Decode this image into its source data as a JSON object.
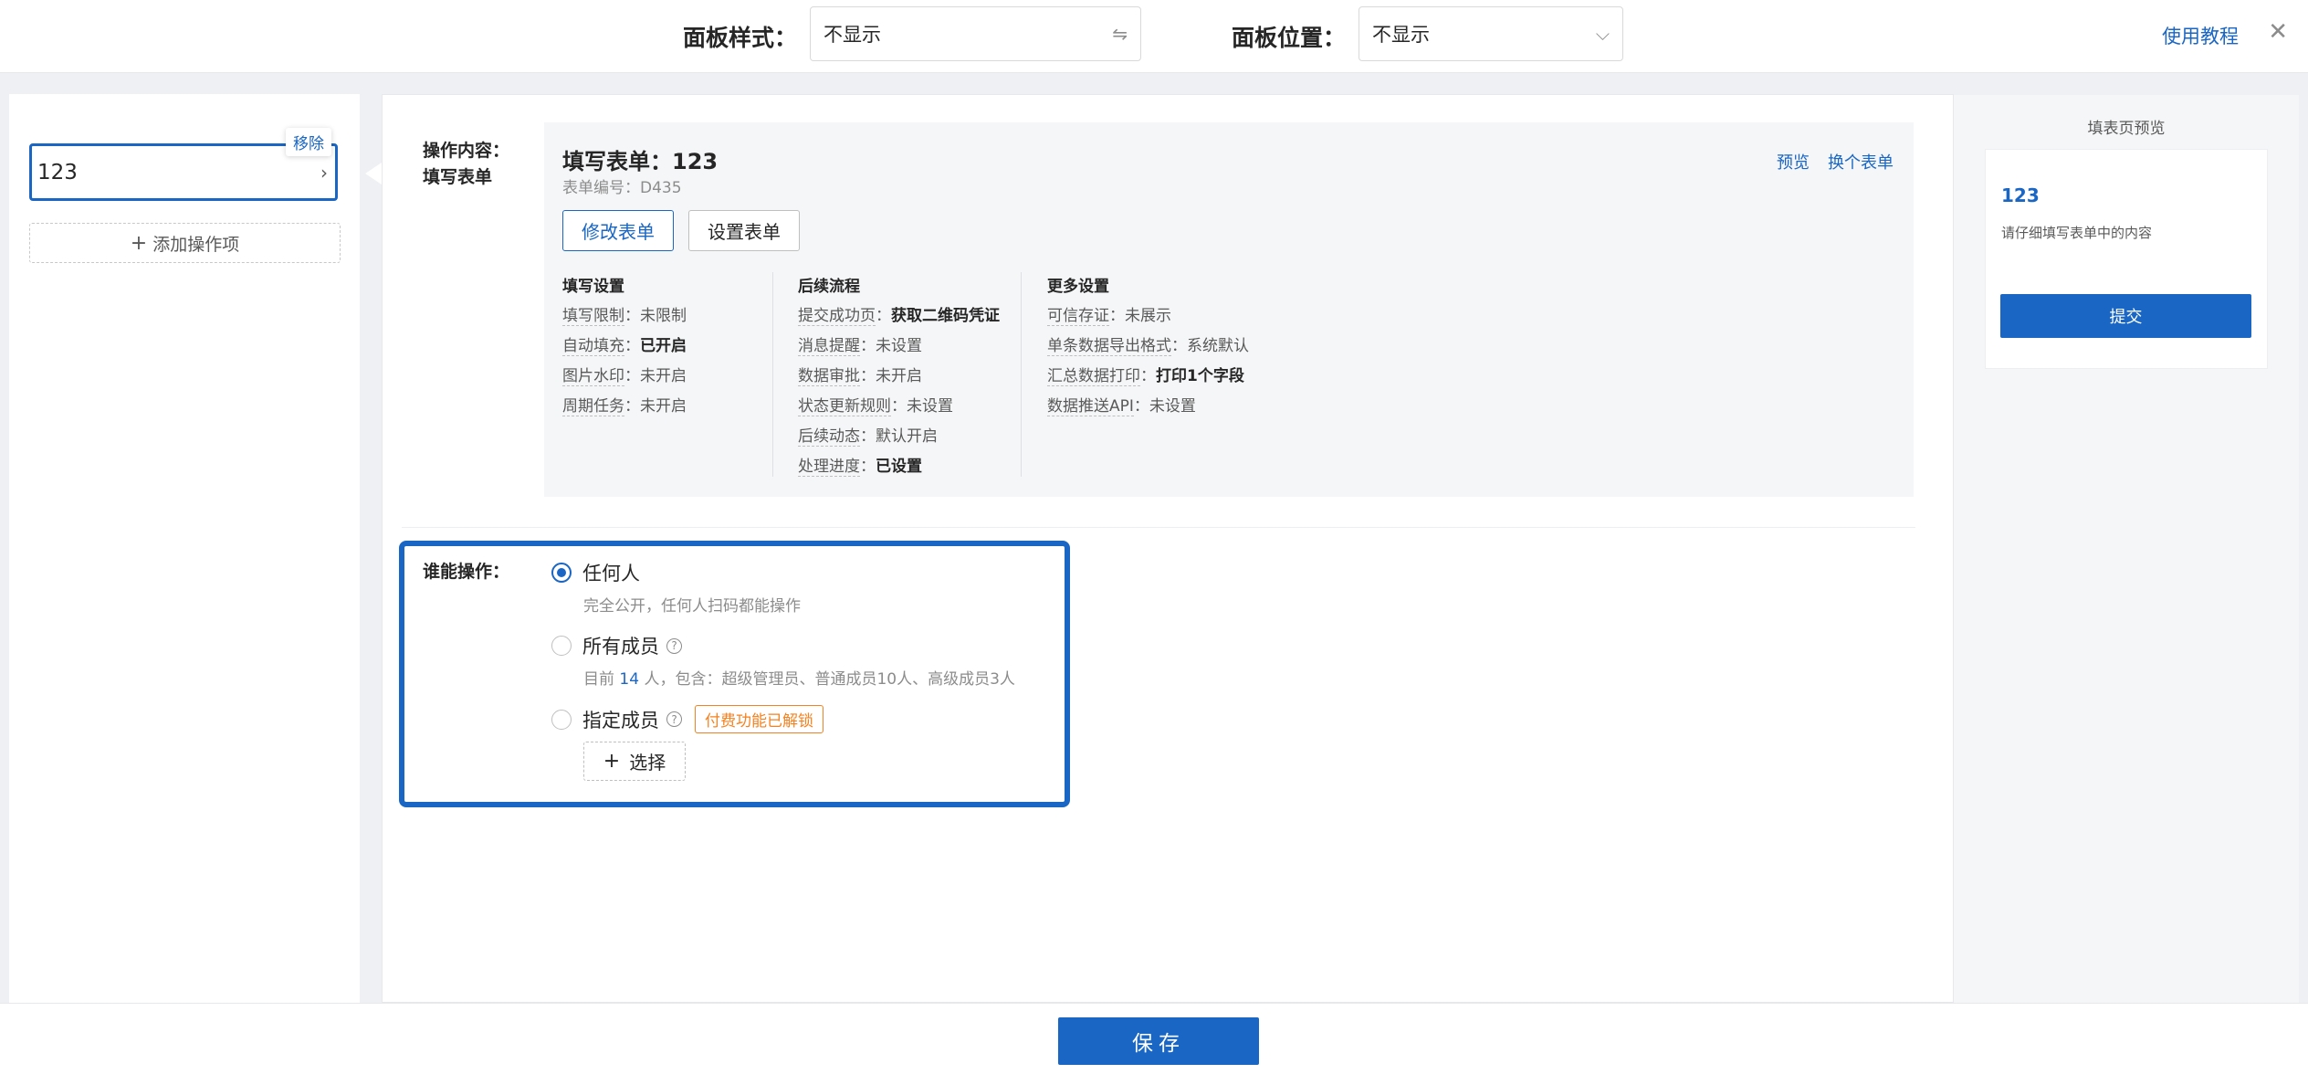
{
  "topbar": {
    "panel_style_label": "面板样式：",
    "panel_style_value": "不显示",
    "panel_style_icon": "swap-arrows-icon",
    "panel_position_label": "面板位置：",
    "panel_position_value": "不显示",
    "panel_position_icon": "chevron-down-icon",
    "tutorial_link": "使用教程",
    "close_icon": "close-icon",
    "close_glyph": "✕"
  },
  "left": {
    "op_item_value": "123",
    "remove_label": "移除",
    "add_op_label": "添加操作项"
  },
  "main": {
    "content_label_1": "操作内容：",
    "content_label_2": "填写表单",
    "form_title": "填写表单：123",
    "form_code": "表单编号：D435",
    "preview_link": "预览",
    "switch_form_link": "换个表单",
    "edit_form_button": "修改表单",
    "form_settings_button": "设置表单",
    "columns": [
      {
        "heading": "填写设置",
        "rows": [
          {
            "k": "填写限制",
            "v": "未限制",
            "bold": false
          },
          {
            "k": "自动填充",
            "v": "已开启",
            "bold": true
          },
          {
            "k": "图片水印",
            "v": "未开启",
            "bold": false
          },
          {
            "k": "周期任务",
            "v": "未开启",
            "bold": false
          }
        ]
      },
      {
        "heading": "后续流程",
        "rows": [
          {
            "k": "提交成功页",
            "v": "获取二维码凭证",
            "bold": true
          },
          {
            "k": "消息提醒",
            "v": "未设置",
            "bold": false
          },
          {
            "k": "数据审批",
            "v": "未开启",
            "bold": false
          },
          {
            "k": "状态更新规则",
            "v": "未设置",
            "bold": false
          },
          {
            "k": "后续动态",
            "v": "默认开启",
            "bold": false
          },
          {
            "k": "处理进度",
            "v": "已设置",
            "bold": true
          }
        ]
      },
      {
        "heading": "更多设置",
        "rows": [
          {
            "k": "可信存证",
            "v": "未展示",
            "bold": false
          },
          {
            "k": "单条数据导出格式",
            "v": "系统默认",
            "bold": false
          },
          {
            "k": "汇总数据打印",
            "v": "打印1个字段",
            "bold": true
          },
          {
            "k": "数据推送API",
            "v": "未设置",
            "bold": false
          }
        ]
      }
    ],
    "who_label": "谁能操作：",
    "options": {
      "anyone": {
        "label": "任何人",
        "desc": "完全公开，任何人扫码都能操作",
        "selected": true
      },
      "all_members": {
        "label": "所有成员",
        "desc_prefix": "目前",
        "count": "14",
        "desc_suffix": "人，包含：超级管理员、普通成员10人、高级成员3人",
        "selected": false
      },
      "specific_members": {
        "label": "指定成员",
        "tag": "付费功能已解锁",
        "selected": false
      }
    },
    "select_button": "选择"
  },
  "preview": {
    "title": "填表页预览",
    "form_name": "123",
    "hint": "请仔细填写表单中的内容",
    "submit": "提交"
  },
  "bottom": {
    "save": "保存"
  },
  "colors": {
    "accent": "#1a66c4",
    "paid_tag": "#f58220"
  }
}
